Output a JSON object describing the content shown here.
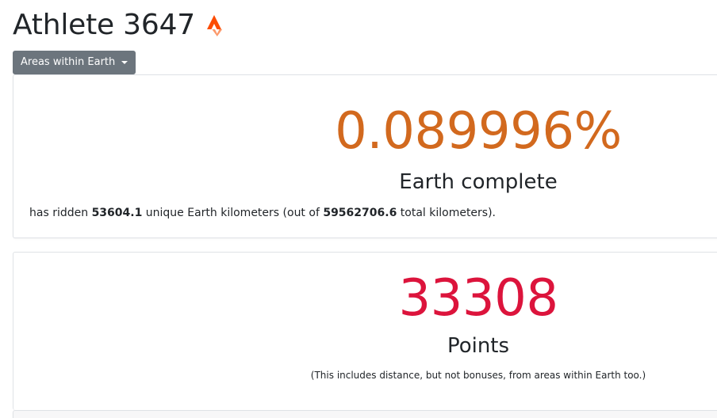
{
  "header": {
    "title": "Athlete 3647",
    "strava_icon": "strava-logo-icon",
    "strava_color": "#fc4c02"
  },
  "area_dropdown": {
    "label": "Areas within Earth"
  },
  "completion_card": {
    "percent": "0.089996%",
    "percent_color": "#d2691e",
    "label": "Earth complete",
    "ridden_prefix": "has ridden ",
    "unique_km": "53604.1",
    "ridden_middle": " unique Earth kilometers (out of ",
    "total_km": "59562706.6",
    "ridden_suffix": " total kilometers)."
  },
  "points_card": {
    "points": "33308",
    "points_color": "#dc143c",
    "label": "Points",
    "note": "(This includes distance, but not bonuses, from areas within Earth too.)"
  }
}
